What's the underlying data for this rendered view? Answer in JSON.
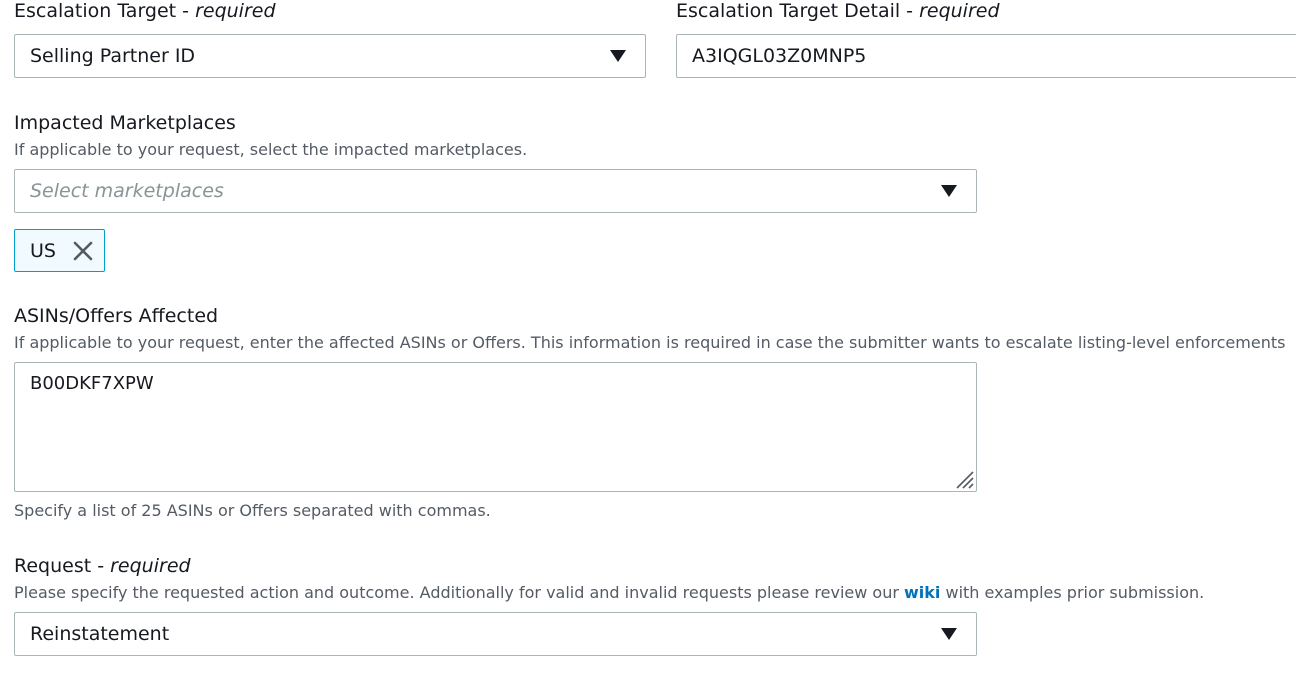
{
  "escalation_target": {
    "label": "Escalation Target",
    "separator": " - ",
    "required": "required",
    "selected": "Selling Partner ID"
  },
  "escalation_target_detail": {
    "label": "Escalation Target Detail",
    "separator": " - ",
    "required": "required",
    "value": "A3IQGL03Z0MNP5"
  },
  "impacted_marketplaces": {
    "label": "Impacted Marketplaces",
    "description": "If applicable to your request, select the impacted marketplaces.",
    "placeholder": "Select marketplaces",
    "tokens": [
      "US"
    ]
  },
  "asins_offers": {
    "label": "ASINs/Offers Affected",
    "description": "If applicable to your request, enter the affected ASINs or Offers. This information is required in case the submitter wants to escalate listing-level enforcements",
    "value": "B00DKF7XPW",
    "hint": "Specify a list of 25 ASINs or Offers separated with commas."
  },
  "request": {
    "label": "Request",
    "separator": " - ",
    "required": "required",
    "description_before": "Please specify the requested action and outcome. Additionally for valid and invalid requests please review our ",
    "link_text": "wiki",
    "description_after": " with examples prior submission.",
    "selected": "Reinstatement"
  },
  "icons": {
    "dropdown": "caret-down-icon",
    "remove": "close-icon",
    "resize": "resize-handle-icon"
  },
  "colors": {
    "token_border": "#00a1c9",
    "token_background": "#f1faff",
    "link": "#0073bb",
    "placeholder": "#879596"
  }
}
